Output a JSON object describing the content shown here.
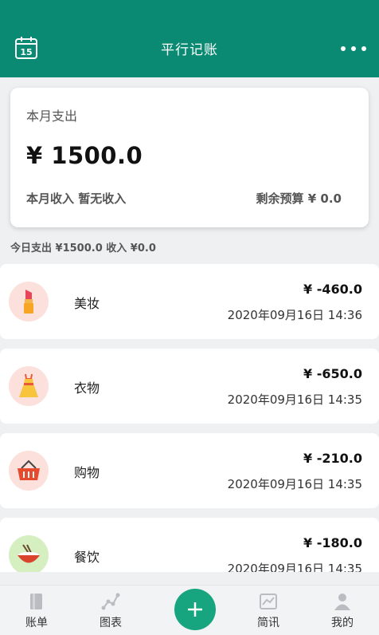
{
  "header": {
    "title": "平行记账",
    "calendar_day": "15"
  },
  "summary": {
    "title": "本月支出",
    "amount": "¥ 1500.0",
    "income": "本月收入 暂无收入",
    "budget": "剩余预算 ¥ 0.0"
  },
  "today": "今日支出 ¥1500.0 收入 ¥0.0",
  "items": [
    {
      "category": "美妆",
      "amount": "¥ -460.0",
      "time": "2020年09月16日 14:36",
      "icon": "lipstick-icon",
      "color": "#fbe0dc"
    },
    {
      "category": "衣物",
      "amount": "¥ -650.0",
      "time": "2020年09月16日 14:35",
      "icon": "dress-icon",
      "color": "#fbe0dc"
    },
    {
      "category": "购物",
      "amount": "¥ -210.0",
      "time": "2020年09月16日 14:35",
      "icon": "shopping-basket-icon",
      "color": "#fbe0dc"
    },
    {
      "category": "餐饮",
      "amount": "¥ -180.0",
      "time": "2020年09月16日 14:35",
      "icon": "food-bowl-icon",
      "color": "#d6efc1"
    }
  ],
  "tabs": [
    {
      "label": "账单",
      "icon": "bill-icon"
    },
    {
      "label": "图表",
      "icon": "chart-icon"
    },
    {
      "label": "简讯",
      "icon": "news-icon"
    },
    {
      "label": "我的",
      "icon": "profile-icon"
    }
  ],
  "colors": {
    "primary": "#0a8a73",
    "fab": "#17a580"
  }
}
